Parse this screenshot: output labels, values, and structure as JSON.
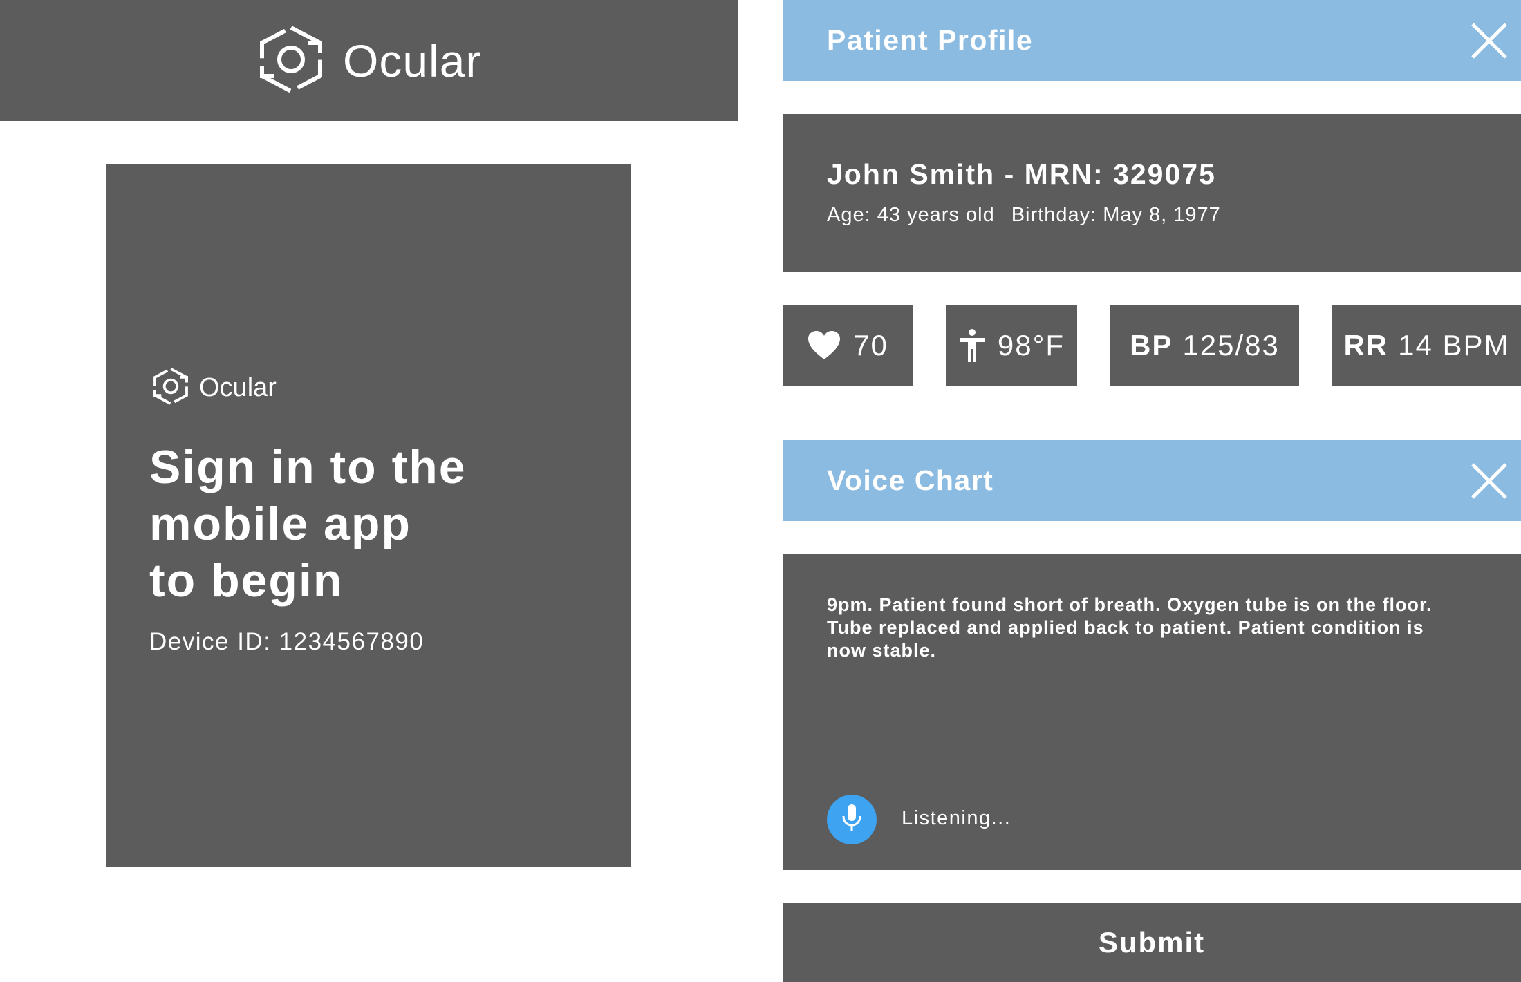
{
  "colors": {
    "panel": "#5c5c5c",
    "header_blue": "#8bbbe0",
    "mic_blue": "#3ea3f0",
    "text": "#ffffff"
  },
  "top_bar": {
    "logo_icon": "ocular-logo-icon",
    "logo_text": "Ocular"
  },
  "signin": {
    "logo_icon": "ocular-logo-icon",
    "logo_text": "Ocular",
    "headline_line1": "Sign in to the",
    "headline_line2": "mobile app",
    "headline_line3": "to begin",
    "device_id": "Device ID: 1234567890"
  },
  "patient_profile": {
    "title": "Patient Profile",
    "close_icon": "close-icon",
    "name_line": "John Smith - MRN: 329075",
    "age": "Age: 43 years old",
    "birthday": "Birthday: May 8, 1977"
  },
  "vitals": {
    "heart_rate": {
      "icon": "heart-icon",
      "value": "70"
    },
    "temperature": {
      "icon": "person-icon",
      "value": "98°F"
    },
    "blood_pressure": {
      "label": "BP",
      "value": "125/83"
    },
    "respiratory_rate": {
      "label": "RR",
      "value": "14 BPM"
    }
  },
  "voice_chart": {
    "title": "Voice Chart",
    "close_icon": "close-icon",
    "transcript": "9pm. Patient found short of breath. Oxygen tube is on the floor. Tube replaced and applied back to patient. Patient condition is now stable.",
    "mic_icon": "microphone-icon",
    "status": "Listening..."
  },
  "submit": {
    "label": "Submit"
  }
}
